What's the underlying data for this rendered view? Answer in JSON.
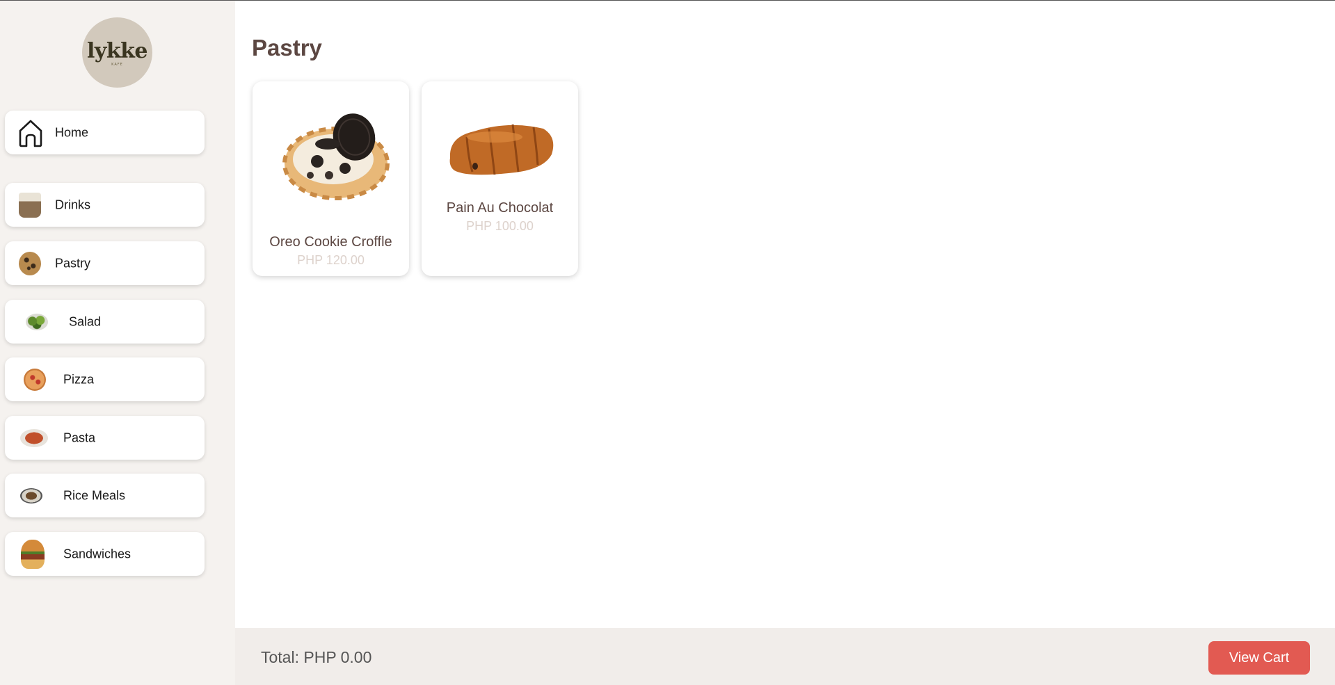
{
  "brand": {
    "logo_text": "lykke",
    "logo_subtext": "KAFE"
  },
  "sidebar": {
    "items": [
      {
        "label": "Home",
        "icon": "home-icon"
      },
      {
        "label": "Drinks",
        "icon": "drinks-thumbnail"
      },
      {
        "label": "Pastry",
        "icon": "pastry-thumbnail"
      },
      {
        "label": "Salad",
        "icon": "salad-thumbnail"
      },
      {
        "label": "Pizza",
        "icon": "pizza-thumbnail"
      },
      {
        "label": "Pasta",
        "icon": "pasta-thumbnail"
      },
      {
        "label": "Rice Meals",
        "icon": "rice-meals-thumbnail"
      },
      {
        "label": "Sandwiches",
        "icon": "sandwich-thumbnail"
      }
    ]
  },
  "main": {
    "title": "Pastry",
    "products": [
      {
        "name": "Oreo Cookie Croffle",
        "price": "PHP 120.00",
        "image": "oreo-croffle-image"
      },
      {
        "name": "Pain Au Chocolat",
        "price": "PHP 100.00",
        "image": "pain-au-chocolat-image"
      }
    ]
  },
  "footer": {
    "total": "Total: PHP 0.00",
    "cart_button": "View Cart"
  },
  "colors": {
    "sidebar_bg": "#f5f2ef",
    "title": "#5c4742",
    "price": "#ddd2cc",
    "cart_button": "#e25a52",
    "footer_bg": "#f1edea",
    "logo_bg": "#d2c9bc"
  }
}
